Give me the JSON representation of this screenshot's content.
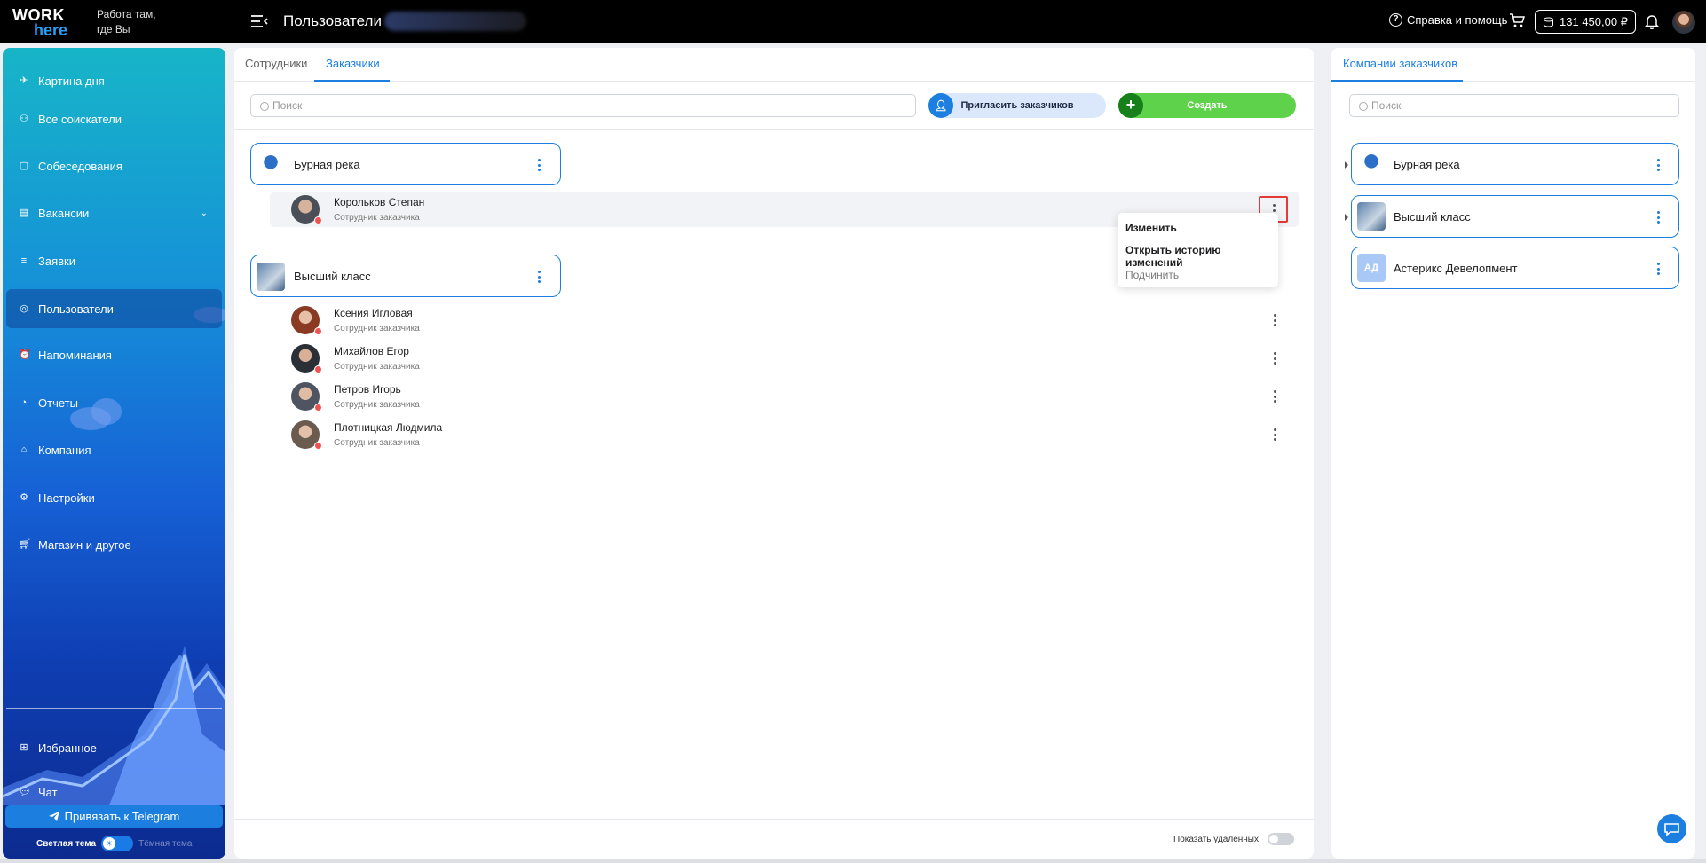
{
  "topbar": {
    "logo_top": "WORK",
    "logo_bottom": "here",
    "tagline_line1": "Работа там,",
    "tagline_line2": "где Вы",
    "page_title": "Пользователи",
    "help_label": "Справка и помощь",
    "balance": "131 450,00 ₽"
  },
  "sidebar": {
    "items": [
      {
        "label": "Картина дня",
        "icon": "rocket-icon"
      },
      {
        "label": "Все соискатели",
        "icon": "people-icon"
      },
      {
        "label": "Собеседования",
        "icon": "calendar-icon"
      },
      {
        "label": "Вакансии",
        "icon": "vacancy-icon"
      },
      {
        "label": "Заявки",
        "icon": "list-icon"
      },
      {
        "label": "Пользователи",
        "icon": "user-circle-icon"
      },
      {
        "label": "Напоминания",
        "icon": "alarm-icon"
      },
      {
        "label": "Отчеты",
        "icon": "report-icon"
      },
      {
        "label": "Компания",
        "icon": "home-icon"
      },
      {
        "label": "Настройки",
        "icon": "gear-icon"
      },
      {
        "label": "Магазин и другое",
        "icon": "cart-icon"
      }
    ],
    "favorites": "Избранное",
    "chat": "Чат",
    "telegram_button": "Привязать к Telegram",
    "theme_light": "Светлая тема",
    "theme_dark": "Тёмная тема"
  },
  "main": {
    "tabs": [
      "Сотрудники",
      "Заказчики"
    ],
    "active_tab": "Заказчики",
    "search_placeholder": "Поиск",
    "invite_button": "Пригласить заказчиков",
    "create_button": "Создать",
    "groups": [
      {
        "company": "Бурная река",
        "members": [
          {
            "name": "Корольков Степан",
            "role": "Сотрудник заказчика"
          }
        ]
      },
      {
        "company": "Высший класс",
        "members": [
          {
            "name": "Ксения Игловая",
            "role": "Сотрудник заказчика"
          },
          {
            "name": "Михайлов Егор",
            "role": "Сотрудник заказчика"
          },
          {
            "name": "Петров Игорь",
            "role": "Сотрудник заказчика"
          },
          {
            "name": "Плотницкая Людмила",
            "role": "Сотрудник заказчика"
          }
        ]
      }
    ],
    "context_menu": {
      "edit": "Изменить",
      "history": "Открыть историю изменений",
      "subordinate": "Подчинить"
    },
    "show_deleted": "Показать удалённых",
    "show_deleted_on": false
  },
  "right_panel": {
    "tab": "Компании заказчиков",
    "search_placeholder": "Поиск",
    "companies": [
      {
        "name": "Бурная река"
      },
      {
        "name": "Высший класс"
      },
      {
        "name": "Астерикс Девелопмент",
        "initials": "АД"
      }
    ]
  },
  "colors": {
    "accent": "#1c7fe0",
    "create_green": "#5fd24b",
    "status_red": "#f05252"
  }
}
